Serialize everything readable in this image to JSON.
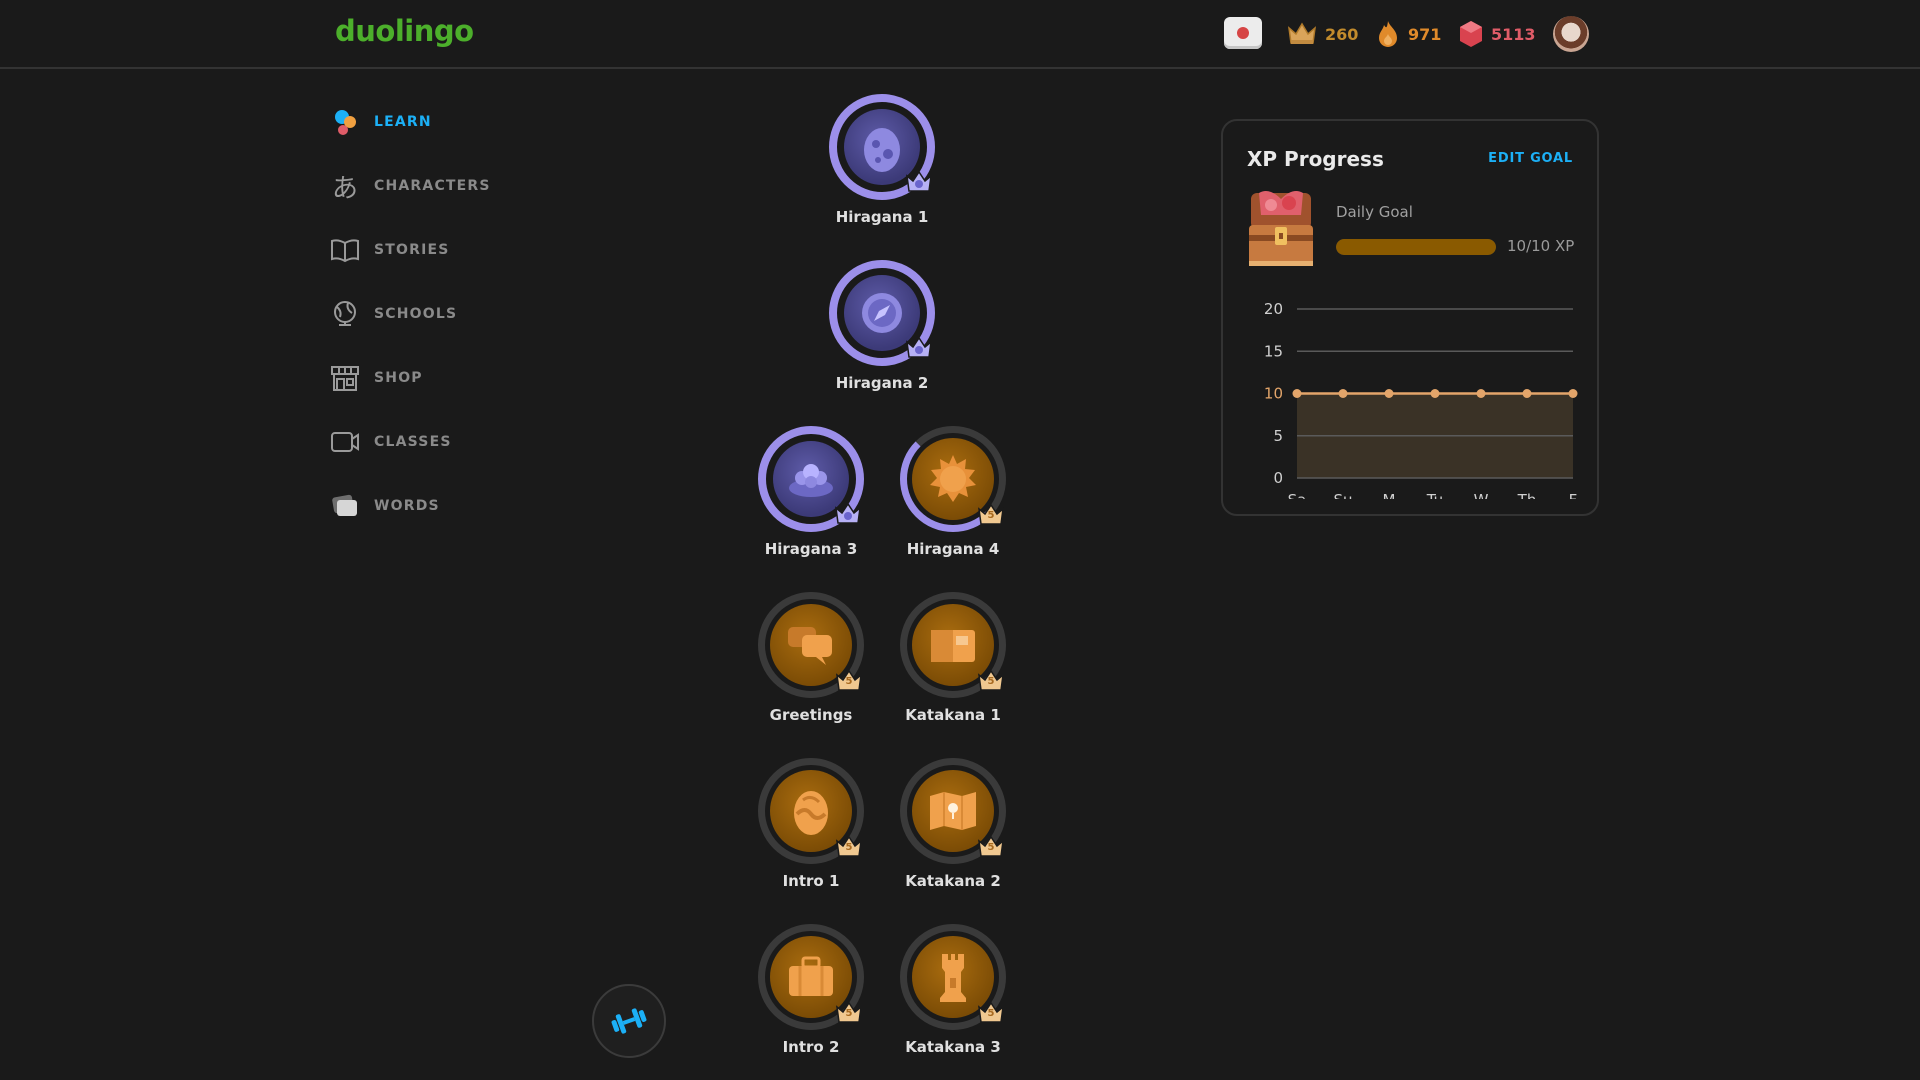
{
  "app": {
    "logo": "duolingo"
  },
  "header": {
    "course_flag": "japan-flag-icon",
    "crowns": "260",
    "streak": "971",
    "gems": "5113",
    "colors": {
      "crowns": "#c28b2c",
      "streak": "#e08a2a",
      "gems": "#e05c68"
    }
  },
  "sidebar": {
    "items": [
      {
        "label": "LEARN",
        "icon": "learn-icon",
        "active": true
      },
      {
        "label": "CHARACTERS",
        "icon": "characters-icon"
      },
      {
        "label": "STORIES",
        "icon": "book-icon"
      },
      {
        "label": "SCHOOLS",
        "icon": "globe-icon"
      },
      {
        "label": "SHOP",
        "icon": "shop-icon"
      },
      {
        "label": "CLASSES",
        "icon": "camera-icon"
      },
      {
        "label": "WORDS",
        "icon": "cards-icon"
      }
    ]
  },
  "skills": [
    {
      "name": "Hiragana 1",
      "style": "legendary",
      "icon": "egg-icon"
    },
    {
      "name": "Hiragana 2",
      "style": "legendary",
      "icon": "compass-icon"
    },
    {
      "name": "Hiragana 3",
      "style": "legendary",
      "icon": "flower-icon"
    },
    {
      "name": "Hiragana 4",
      "style": "gold",
      "icon": "sun-icon",
      "crown": "5"
    },
    {
      "name": "Greetings",
      "style": "gold",
      "icon": "speech-bubbles-icon",
      "crown": "5"
    },
    {
      "name": "Katakana 1",
      "style": "gold",
      "icon": "box-icon",
      "crown": "5"
    },
    {
      "name": "Intro 1",
      "style": "gold",
      "icon": "egg-icon",
      "crown": "5"
    },
    {
      "name": "Katakana 2",
      "style": "gold",
      "icon": "map-icon",
      "crown": "5"
    },
    {
      "name": "Intro 2",
      "style": "gold",
      "icon": "suitcase-icon",
      "crown": "5"
    },
    {
      "name": "Katakana 3",
      "style": "gold",
      "icon": "castle-icon",
      "crown": "5"
    }
  ],
  "practice_button": {
    "icon": "dumbbell-icon"
  },
  "xp_panel": {
    "title": "XP Progress",
    "edit_label": "EDIT GOAL",
    "goal_label": "Daily Goal",
    "goal_text": "10/10 XP",
    "goal_progress": 1.0
  },
  "chart_data": {
    "type": "area",
    "categories": [
      "Sa",
      "Su",
      "M",
      "Tu",
      "W",
      "Th",
      "F"
    ],
    "values": [
      10,
      10,
      10,
      10,
      10,
      10,
      10
    ],
    "yticks": [
      0,
      5,
      10,
      15,
      20
    ],
    "ylim": [
      0,
      20
    ],
    "highlight_tick": 10,
    "grid": true,
    "color": "#e3a56a"
  }
}
